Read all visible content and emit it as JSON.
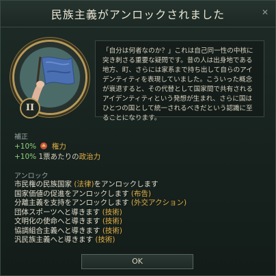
{
  "dialog": {
    "title": "民族主義がアンロックされました",
    "era_badge": "II",
    "description": "「自分は何者なのか？」これは自己同一性の中核に突き刺さる重要な疑問です。昔の人は出身地である地方、町、さらには家系まで持ち出して自らのアイデンティティを表現していました。こういった概念が衰退すると、その代替として国家間で共有されるアイデンティティという発想が生まれ、さらに国はひとつの国として統一されるべきだという認識に至ることになります。",
    "modifiers_label": "補正",
    "modifiers": [
      {
        "value": "+10%",
        "icon": "power-icon",
        "text": "権力"
      },
      {
        "value": "+10%",
        "prefix": "1票あたりの",
        "text": "政治力"
      }
    ],
    "unlocks_label": "アンロック",
    "unlocks": [
      {
        "text": "市民権の民族国家 ",
        "tag": "(法律)",
        "suffix": "をアンロックします"
      },
      {
        "text": "国家価値の促進をアンロックします ",
        "tag": "(布告)",
        "suffix": ""
      },
      {
        "text": "分離主義を支持をアンロックします ",
        "tag": "(外交アクション)",
        "suffix": ""
      },
      {
        "text": "団体スポーツへと導きます ",
        "tag": "(技術)",
        "suffix": ""
      },
      {
        "text": "文明化の使命へと導きます ",
        "tag": "(技術)",
        "suffix": ""
      },
      {
        "text": "協調組合主義へと導きます ",
        "tag": "(技術)",
        "suffix": ""
      },
      {
        "text": "汎民族主義へと導きます ",
        "tag": "(技術)",
        "suffix": ""
      }
    ],
    "ok_label": "OK"
  },
  "colors": {
    "accent": "#e3b047",
    "positive": "#8ed07a",
    "panel": "#1a2622"
  }
}
